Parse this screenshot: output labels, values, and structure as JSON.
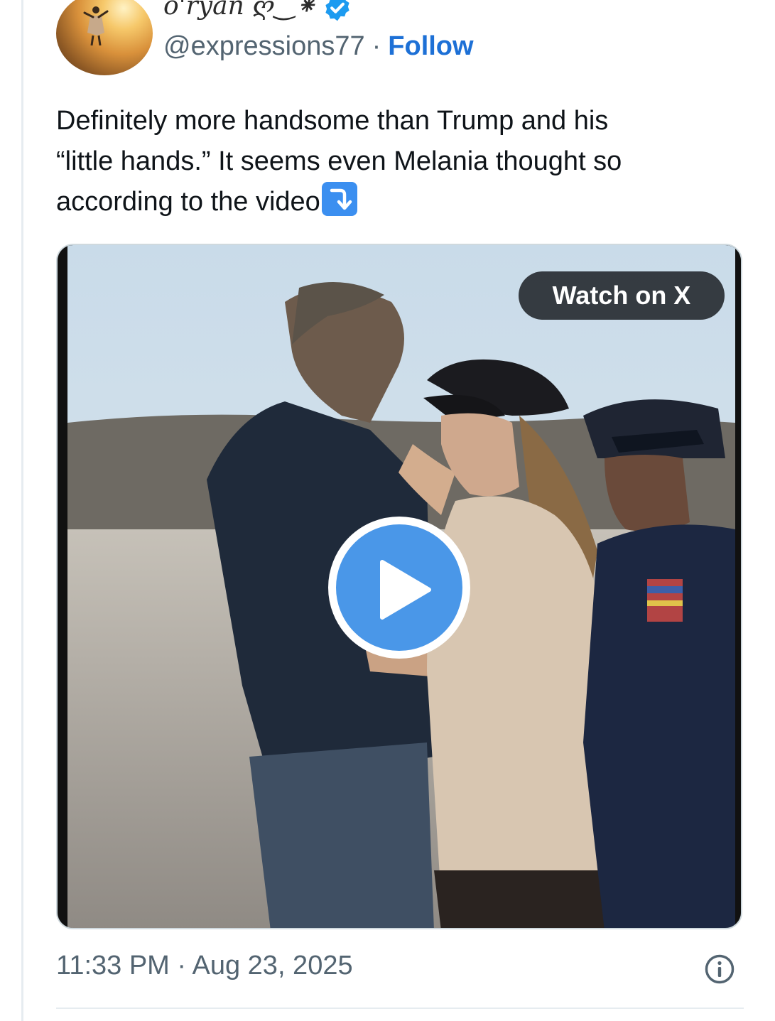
{
  "author": {
    "display_name": "o'ryan ღ‿⁕",
    "handle": "@expressions77",
    "separator": "·",
    "follow_label": "Follow",
    "verified": true,
    "verified_color": "#1d9bf0",
    "avatar_icon": "avatar-photo-sunset-person"
  },
  "tweet": {
    "text": "Definitely more handsome than Trump and his\n“little hands.”  It seems even Melania thought so\naccording to the video",
    "emoji": "⤵",
    "emoji_icon": "arrow-curve-down-icon"
  },
  "media": {
    "type": "video",
    "watch_label": "Watch on X",
    "play_icon": "play-icon"
  },
  "footer": {
    "timestamp": "11:33 PM · Aug 23, 2025",
    "info_icon": "info-icon"
  },
  "colors": {
    "link": "#1d70d6",
    "text": "#0f1419",
    "secondary": "#536471",
    "play_button": "#4a97e8"
  }
}
